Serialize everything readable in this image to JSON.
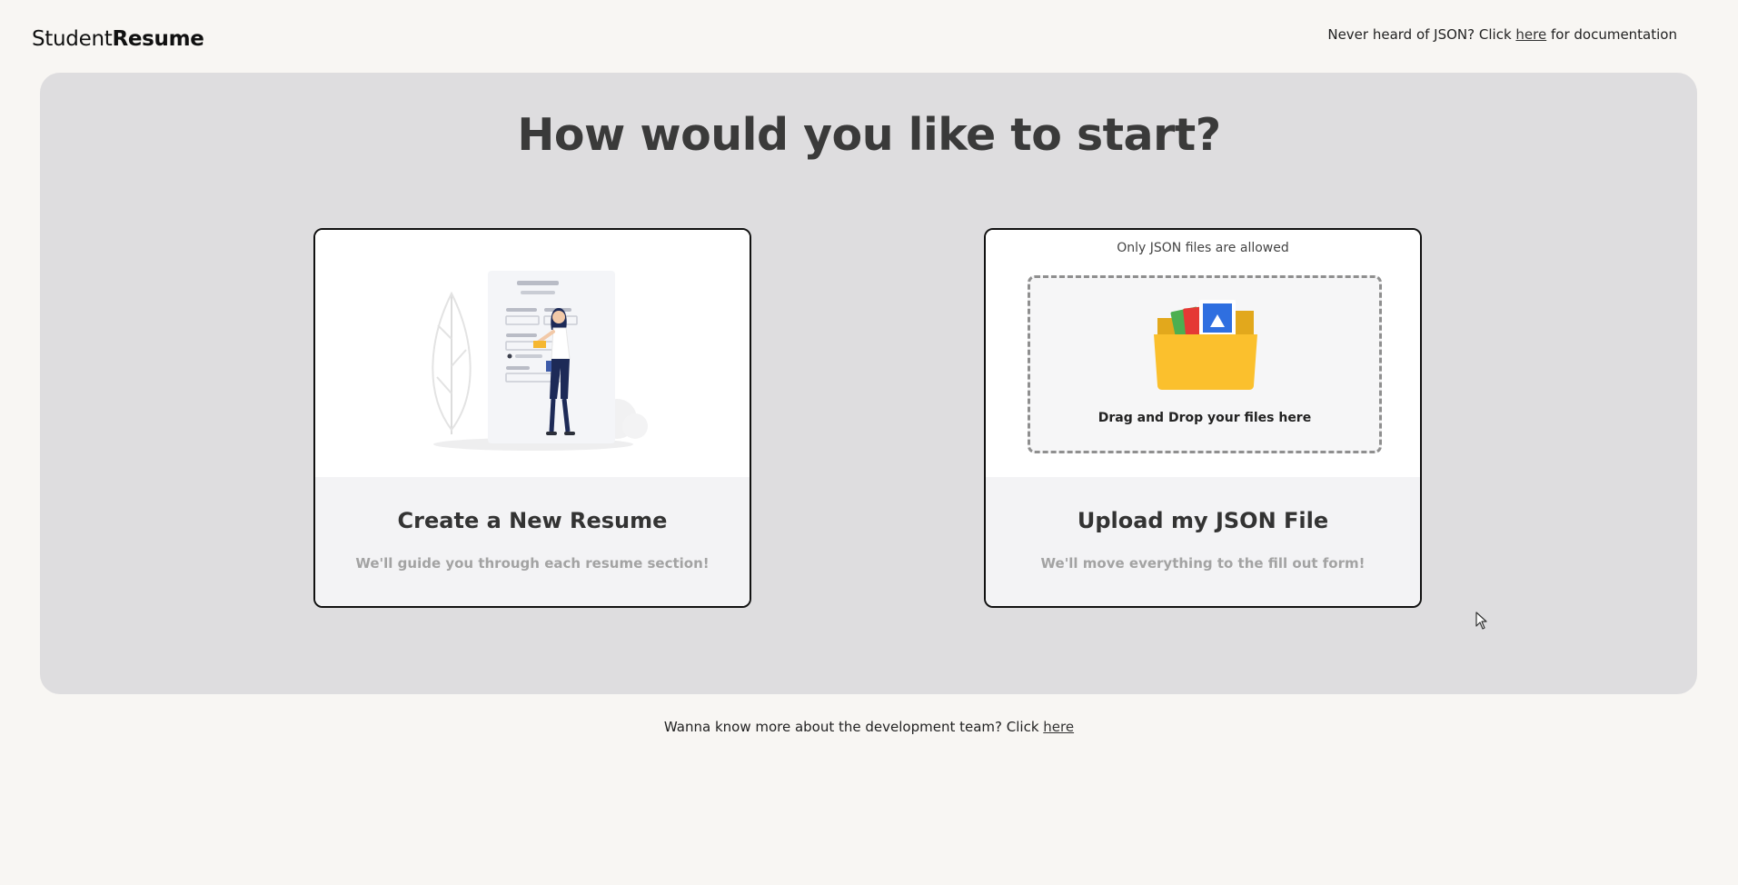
{
  "header": {
    "logo_regular": "Student",
    "logo_bold": "Resume",
    "doc_prefix": "Never heard of JSON? Click ",
    "doc_link": "here",
    "doc_suffix": " for documentation"
  },
  "main": {
    "title": "How would you like to start?",
    "cards": [
      {
        "title": "Create a New Resume",
        "subtitle": "We'll guide you through each resume section!",
        "icon": "resume-form-illustration"
      },
      {
        "title": "Upload my JSON File",
        "subtitle": "We'll move everything to the fill out form!",
        "note": "Only JSON files are allowed",
        "dropzone_label": "Drag and Drop your files here",
        "icon": "folder-icon"
      }
    ]
  },
  "footer": {
    "prefix": "Wanna know more about the development team? Click ",
    "link": "here"
  },
  "colors": {
    "page_bg": "#f8f6f3",
    "panel_bg": "#dedddf",
    "card_border": "#111111",
    "folder": "#fbc02d",
    "accent_blue": "#2f6fe0"
  }
}
